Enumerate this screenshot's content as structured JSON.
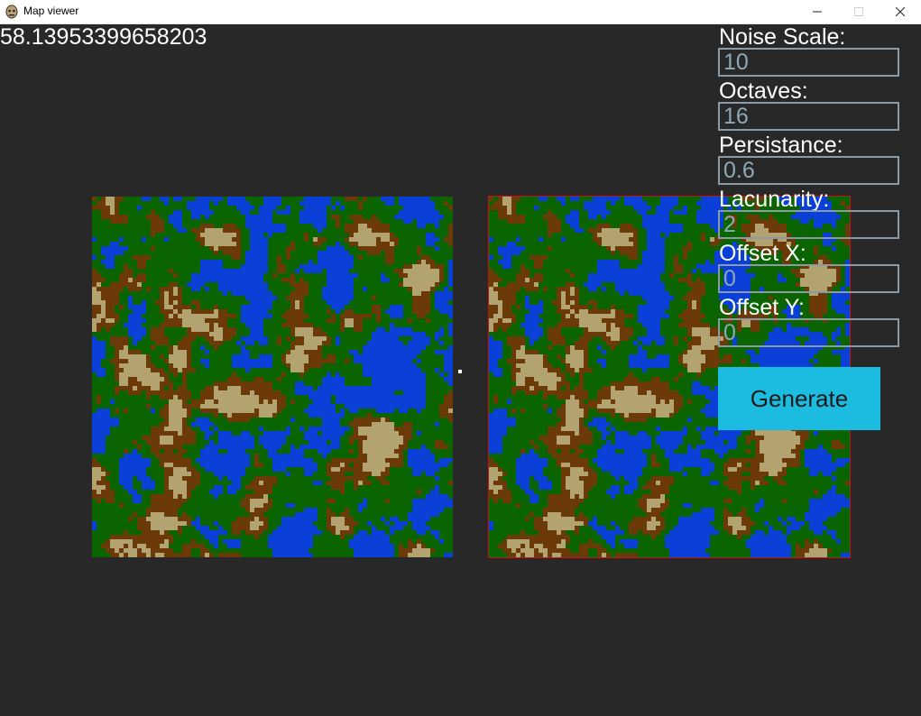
{
  "window": {
    "title": "Map viewer",
    "controls": [
      "minimize-icon",
      "maximize-icon",
      "close-icon"
    ]
  },
  "fps_readout": "58.13953399658203",
  "controls_panel": {
    "noise_scale": {
      "label": "Noise Scale:",
      "value": "10"
    },
    "octaves": {
      "label": "Octaves:",
      "value": "16"
    },
    "persistance": {
      "label": "Persistance:",
      "value": "0.6"
    },
    "lacunarity": {
      "label": "Lacunarity:",
      "value": "2"
    },
    "offset_x": {
      "label": "Offset X:",
      "value": "0"
    },
    "offset_y": {
      "label": "Offset Y:",
      "value": "0"
    },
    "generate_label": "Generate"
  },
  "colors": {
    "background": "#282828",
    "water": "#0a3fd8",
    "grass": "#0a6400",
    "dirt": "#6b3a08",
    "sand": "#b3a371",
    "generate_button": "#1bbcdf",
    "right_map_border": "#c01818"
  }
}
